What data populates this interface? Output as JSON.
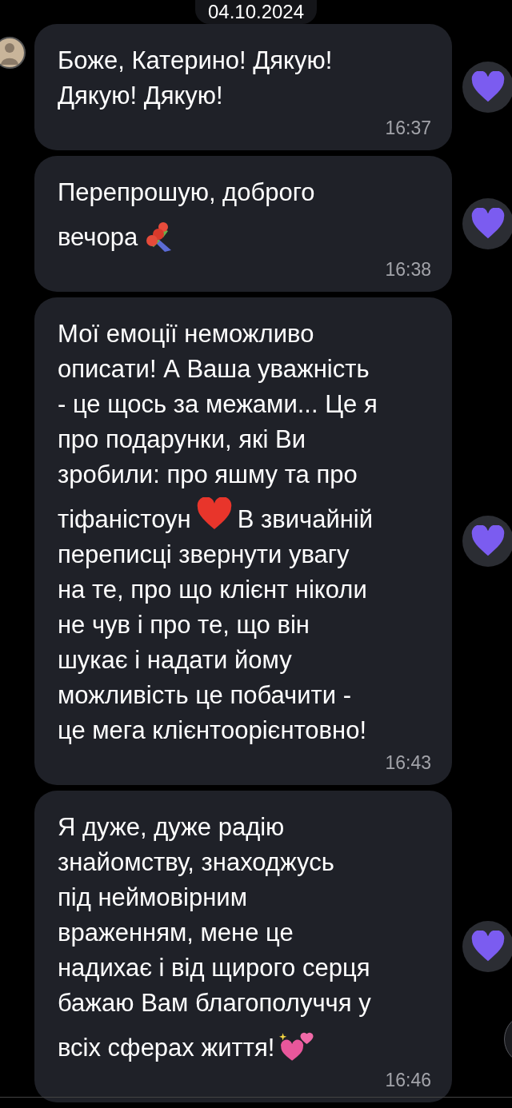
{
  "date_label": "04.10.2024",
  "messages": [
    {
      "lines": [
        {
          "parts": [
            {
              "kind": "text",
              "text": "Боже, Катерино! Дякую!"
            }
          ]
        },
        {
          "parts": [
            {
              "kind": "text",
              "text": "Дякую! Дякую!"
            }
          ]
        }
      ],
      "time": "16:37",
      "reacted": true
    },
    {
      "lines": [
        {
          "parts": [
            {
              "kind": "text",
              "text": "Перепрошую, доброго"
            }
          ]
        },
        {
          "parts": [
            {
              "kind": "text",
              "text": "вечора"
            },
            {
              "kind": "bouquet"
            }
          ]
        }
      ],
      "time": "16:38",
      "reacted": true
    },
    {
      "lines": [
        {
          "parts": [
            {
              "kind": "text",
              "text": "Мої емоції неможливо"
            }
          ]
        },
        {
          "parts": [
            {
              "kind": "text",
              "text": "описати! А Ваша уважність"
            }
          ]
        },
        {
          "parts": [
            {
              "kind": "text",
              "text": "- це щось за межами... Це я"
            }
          ]
        },
        {
          "parts": [
            {
              "kind": "text",
              "text": "про подарунки, які Ви"
            }
          ]
        },
        {
          "parts": [
            {
              "kind": "text",
              "text": "зробили: про яшму та про"
            }
          ]
        },
        {
          "parts": [
            {
              "kind": "text",
              "text": "тіфаністоун"
            },
            {
              "kind": "heart"
            },
            {
              "kind": "text",
              "text": "В звичайній"
            }
          ]
        },
        {
          "parts": [
            {
              "kind": "text",
              "text": "переписці звернути увагу"
            }
          ]
        },
        {
          "parts": [
            {
              "kind": "text",
              "text": "на те, про що клієнт ніколи"
            }
          ]
        },
        {
          "parts": [
            {
              "kind": "text",
              "text": "не чув і про те, що він"
            }
          ]
        },
        {
          "parts": [
            {
              "kind": "text",
              "text": "шукає і надати йому"
            }
          ]
        },
        {
          "parts": [
            {
              "kind": "text",
              "text": "можливість це побачити -"
            }
          ]
        },
        {
          "parts": [
            {
              "kind": "text",
              "text": "це мега клієнтоорієнтовно!"
            }
          ]
        }
      ],
      "time": "16:43",
      "reacted": true
    },
    {
      "lines": [
        {
          "parts": [
            {
              "kind": "text",
              "text": "Я дуже, дуже радію"
            }
          ]
        },
        {
          "parts": [
            {
              "kind": "text",
              "text": "знайомству, знаходжусь"
            }
          ]
        },
        {
          "parts": [
            {
              "kind": "text",
              "text": "під неймовірним"
            }
          ]
        },
        {
          "parts": [
            {
              "kind": "text",
              "text": "враженням, мене це"
            }
          ]
        },
        {
          "parts": [
            {
              "kind": "text",
              "text": "надихає і від щирого серця"
            }
          ]
        },
        {
          "parts": [
            {
              "kind": "text",
              "text": "бажаю Вам благополуччя у"
            }
          ]
        },
        {
          "parts": [
            {
              "kind": "text",
              "text": "всіх сферах життя!"
            },
            {
              "kind": "hearts"
            }
          ]
        }
      ],
      "time": "16:46",
      "reacted": true
    }
  ]
}
